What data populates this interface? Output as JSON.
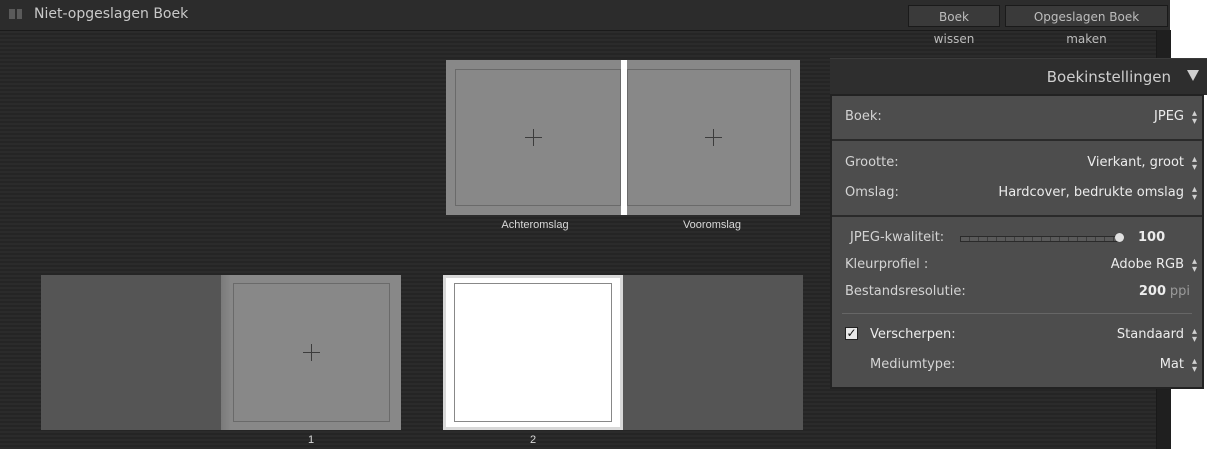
{
  "topbar": {
    "title": "Niet-opgeslagen Boek",
    "clear_button": "Boek wissen",
    "create_button": "Opgeslagen Boek maken"
  },
  "cover": {
    "back_label": "Achteromslag",
    "front_label": "Vooromslag"
  },
  "spreads": {
    "page1_number": "1",
    "page2_number": "2"
  },
  "panel": {
    "title": "Boekinstellingen",
    "book_label": "Boek:",
    "book_value": "JPEG",
    "size_label": "Grootte:",
    "size_value": "Vierkant, groot",
    "cover_label": "Omslag:",
    "cover_value": "Hardcover, bedrukte omslag",
    "quality_label": "JPEG-kwaliteit:",
    "quality_value": "100",
    "quality_fraction": 1.0,
    "profile_label": "Kleurprofiel :",
    "profile_value": "Adobe RGB",
    "resolution_label": "Bestandsresolutie:",
    "resolution_value": "200",
    "resolution_unit": "ppi",
    "sharpen_label": "Verscherpen:",
    "sharpen_checked": true,
    "sharpen_value": "Standaard",
    "media_label": "Mediumtype:",
    "media_value": "Mat"
  },
  "icons": {
    "updown": "updown-arrows-icon",
    "collapse": "triangle-down-icon",
    "add_photo": "plus-icon",
    "check": "checkmark-icon"
  }
}
